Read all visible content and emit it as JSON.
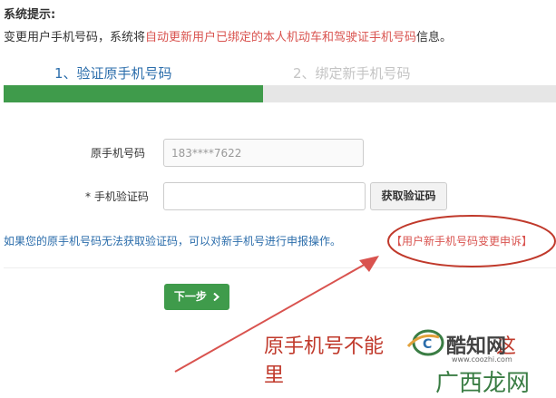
{
  "notice": {
    "title": "系统提示:",
    "body_prefix": "变更用户手机号码，系统将",
    "body_highlight": "自动更新用户已绑定的本人机动车和驾驶证手机号码",
    "body_suffix": "信息。"
  },
  "steps": [
    {
      "label": "1、验证原手机号码",
      "state": "active"
    },
    {
      "label": "2、绑定新手机号码",
      "state": "inactive"
    }
  ],
  "progress": {
    "fraction": 0.47,
    "color": "#3f9b4b"
  },
  "form": {
    "phone_label": "原手机号码",
    "phone_value": "183****7622",
    "code_label": "* 手机验证码",
    "code_value": "",
    "get_code_label": "获取验证码"
  },
  "hint": {
    "text": "如果您的原手机号码无法获取验证码，可以对新手机号进行申报操作。",
    "link": "【用户新手机号码变更申诉】"
  },
  "next_button": {
    "label": "下一步",
    "icon": "chevron-right-icon"
  },
  "annotation": {
    "text_line1": "原手机号不能",
    "text_tail1": "这",
    "text_line2": "里",
    "color": "#c0392b"
  },
  "watermark": {
    "brand": "酷知网",
    "url": "www.coozhi.com",
    "bottom": "广西龙网"
  },
  "colors": {
    "accent_blue": "#2b6dab",
    "accent_green": "#3f9b4b",
    "warning_red": "#d9534f"
  }
}
